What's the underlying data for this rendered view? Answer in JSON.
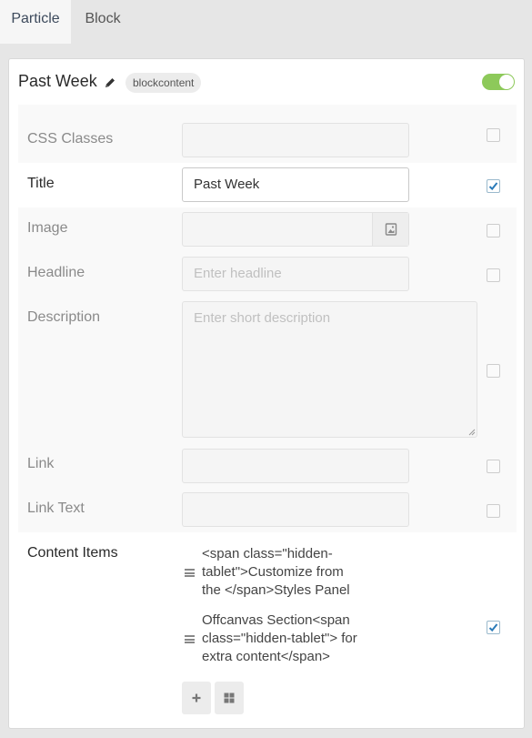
{
  "tabs": [
    {
      "label": "Particle",
      "active": true
    },
    {
      "label": "Block",
      "active": false
    }
  ],
  "header": {
    "title": "Past Week",
    "badge": "blockcontent",
    "enabled": true
  },
  "form": {
    "css_classes": {
      "label": "CSS Classes",
      "value": "",
      "checked": false
    },
    "title": {
      "label": "Title",
      "value": "Past Week",
      "checked": true
    },
    "image": {
      "label": "Image",
      "value": "",
      "checked": false
    },
    "headline": {
      "label": "Headline",
      "placeholder": "Enter headline",
      "checked": false
    },
    "description": {
      "label": "Description",
      "placeholder": "Enter short description",
      "checked": false
    },
    "link": {
      "label": "Link",
      "value": "",
      "checked": false
    },
    "link_text": {
      "label": "Link Text",
      "value": "",
      "checked": false
    },
    "content_items": {
      "label": "Content Items",
      "checked": true,
      "items": [
        {
          "line1": "<span class=\"hidden-",
          "line2": "tablet\">Customize from",
          "line3": "the </span>Styles Panel"
        },
        {
          "line1": "Offcanvas Section<span",
          "line2": "class=\"hidden-tablet\"> for",
          "line3": "extra content</span>"
        }
      ]
    }
  },
  "colors": {
    "toggle_on": "#8dc95a",
    "check": "#2b7bb9"
  }
}
